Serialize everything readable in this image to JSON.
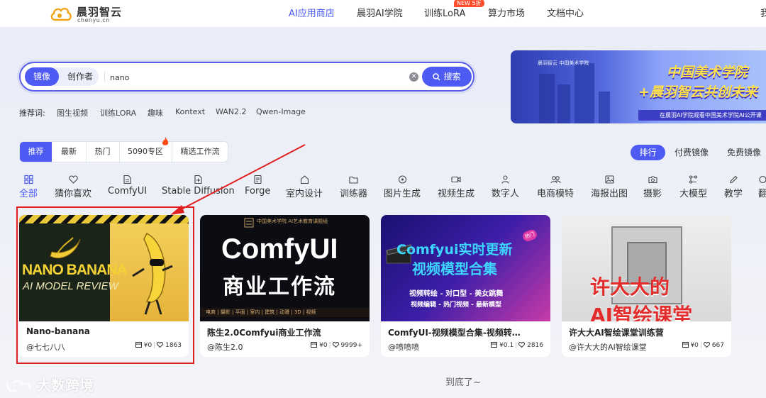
{
  "header": {
    "logo_cn": "晨羽智云",
    "logo_en": "chenyu.cn",
    "nav": [
      "AI应用商店",
      "晨羽AI学院",
      "训练LoRA",
      "算力市场",
      "文档中心"
    ],
    "nav_badge": "NEW 5折",
    "right_text": "我"
  },
  "search": {
    "tabs": [
      "镜像",
      "创作者"
    ],
    "value": "nano",
    "button_label": "搜索"
  },
  "recommend": {
    "label": "推荐词:",
    "tags": [
      "图生视频",
      "训练LORA",
      "趣味",
      "Kontext",
      "WAN2.2",
      "Qwen-Image"
    ]
  },
  "banner": {
    "logos": "晨羽智云   中国美术学院",
    "title_line1": "中国美术学院",
    "title_line2": "+晨羽智云共创未来",
    "subtitle": "在晨羽AI学院观看中国美术学院AI公开课"
  },
  "filters": [
    "推荐",
    "最新",
    "热门",
    "5090专区",
    "精选工作流"
  ],
  "ranking": [
    "排行",
    "付费镜像",
    "免费镜像"
  ],
  "categories": [
    {
      "label": "全部",
      "icon": "grid-icon"
    },
    {
      "label": "猜你喜欢",
      "icon": "heart-icon"
    },
    {
      "label": "ComfyUI",
      "icon": "document-icon"
    },
    {
      "label": "Stable Diffusion",
      "icon": "document-plus-icon"
    },
    {
      "label": "Forge",
      "icon": "list-document-icon"
    },
    {
      "label": "室内设计",
      "icon": "home-icon"
    },
    {
      "label": "训练器",
      "icon": "folder-icon"
    },
    {
      "label": "图片生成",
      "icon": "dial-icon"
    },
    {
      "label": "视频生成",
      "icon": "video-icon"
    },
    {
      "label": "数字人",
      "icon": "person-icon"
    },
    {
      "label": "电商模特",
      "icon": "users-icon"
    },
    {
      "label": "海报出图",
      "icon": "image-icon"
    },
    {
      "label": "摄影",
      "icon": "camera-icon"
    },
    {
      "label": "大模型",
      "icon": "model-icon"
    },
    {
      "label": "教学",
      "icon": "pen-icon"
    },
    {
      "label": "翻",
      "icon": "more-icon"
    }
  ],
  "cards": [
    {
      "title": "Nano-banana",
      "author": "@七七八八",
      "price": "¥0",
      "likes": "1863",
      "thumb": {
        "line1": "NANO BANANA",
        "line2": "AI MODEL REVIEW"
      }
    },
    {
      "title": "陈生2.0Comfyui商业工作流",
      "author": "@陈生2.0",
      "price": "¥0",
      "likes": "9999+",
      "thumb": {
        "line1": "ComfyUI",
        "line2": "商业工作流",
        "header": "中国美术学院   AI艺术教育课题组",
        "bar": "电商 | 摄影 | 平面 | 室内 | 建筑 | 动漫 | 3D | 视频"
      }
    },
    {
      "title": "ComfyUI-视频模型合集-视频转…",
      "author": "@喷喷喷",
      "price": "¥0.1",
      "likes": "2816",
      "thumb": {
        "line1": "Comfyui实时更新",
        "line2": "视频模型合集",
        "sub1": "视频转绘 - 对口型 - 美女跳舞",
        "sub2": "视频编辑 - 热门视频 - 最新模型",
        "tag": "热门"
      }
    },
    {
      "title": "许大大AI智绘课堂训练营",
      "author": "@许大大的AI智绘课堂",
      "price": "¥0",
      "likes": "667",
      "thumb": {
        "line1": "许大大的",
        "line2": "AI智绘课堂"
      }
    }
  ],
  "footer": {
    "end_text": "到底了~",
    "watermark": "大数跨境"
  },
  "colors": {
    "accent": "#4e5bf2",
    "highlight": "#e02020"
  }
}
